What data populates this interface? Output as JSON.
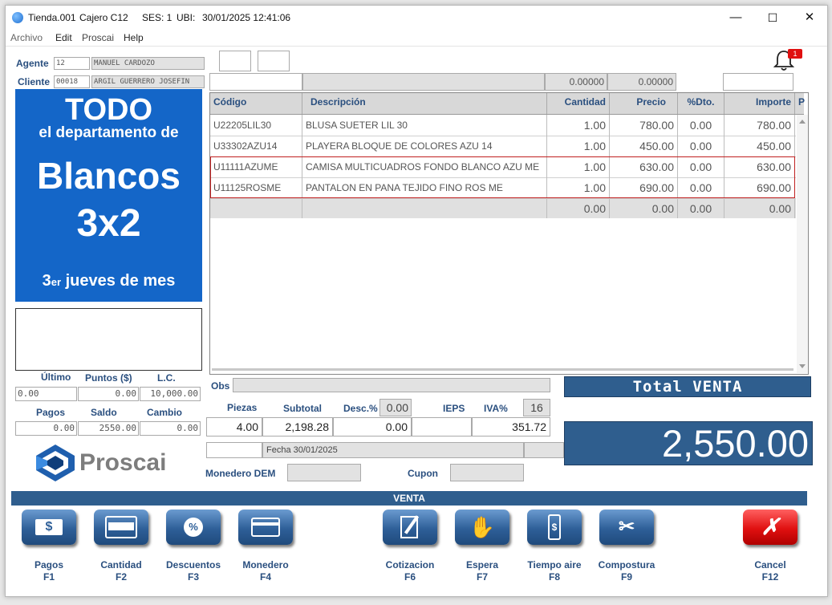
{
  "titlebar": {
    "store": "Tienda.001",
    "cashier": "Cajero C12",
    "session": "SES: 1",
    "ubi": "UBI:",
    "datetime": "30/01/2025 12:41:06",
    "minimize": "—",
    "maximize": "☐",
    "close": "✕"
  },
  "menu": {
    "archivo": "Archivo",
    "edit": "Edit",
    "proscai": "Proscai",
    "help": "Help"
  },
  "agent": {
    "label": "Agente",
    "code": "12",
    "name": "MANUEL CARDOZO"
  },
  "client": {
    "label": "Cliente",
    "code": "00018",
    "name": "ARGIL  GUERRERO JOSEFIN"
  },
  "notifications": {
    "count": "1",
    "icon": "bell-icon"
  },
  "top_fields": {
    "val1": "0.00000",
    "val2": "0.00000"
  },
  "banner": {
    "l1": "TODO",
    "l2": "el departamento de",
    "l3": "Blancos",
    "l4": "3x2",
    "l5_pre": "3",
    "l5_sup": "er",
    "l5_post": " jueves de mes"
  },
  "table": {
    "headers": [
      "Código",
      "Descripción",
      "Cantidad",
      "Precio",
      "%Dto.",
      "Importe",
      "P"
    ],
    "rows": [
      {
        "code": "U22205LIL30",
        "desc": "BLUSA SUETER LIL 30",
        "qty": "1.00",
        "price": "780.00",
        "dto": "0.00",
        "imp": "780.00"
      },
      {
        "code": "U33302AZU14",
        "desc": "PLAYERA BLOQUE DE COLORES AZU 14",
        "qty": "1.00",
        "price": "450.00",
        "dto": "0.00",
        "imp": "450.00"
      },
      {
        "code": "U11111AZUME",
        "desc": "CAMISA MULTICUADROS FONDO BLANCO AZU ME",
        "qty": "1.00",
        "price": "630.00",
        "dto": "0.00",
        "imp": "630.00"
      },
      {
        "code": "U11125ROSME",
        "desc": "PANTALON EN PANA  TEJIDO FINO ROS ME",
        "qty": "1.00",
        "price": "690.00",
        "dto": "0.00",
        "imp": "690.00"
      }
    ],
    "totals": {
      "qty": "0.00",
      "price": "0.00",
      "dto": "0.00",
      "imp": "0.00"
    }
  },
  "left_stats": {
    "ultimo_label": "Último",
    "puntos_label": "Puntos ($)",
    "lc_label": "L.C.",
    "ultimo": "0.00",
    "puntos": "0.00",
    "lc": "10,000.00",
    "pagos_label": "Pagos",
    "saldo_label": "Saldo",
    "cambio_label": "Cambio",
    "pagos": "0.00",
    "saldo": "2550.00",
    "cambio": "0.00"
  },
  "logo": {
    "name": "Proscai"
  },
  "obs": {
    "label": "Obs"
  },
  "totals": {
    "piezas_label": "Piezas",
    "subtotal_label": "Subtotal",
    "desc_label": "Desc.%",
    "desc_pct": "0.00",
    "ieps_label": "IEPS",
    "iva_label": "IVA%",
    "iva_pct": "16",
    "piezas": "4.00",
    "subtotal": "2,198.28",
    "descuento": "0.00",
    "ieps": "",
    "iva": "351.72",
    "fecha": "Fecha 30/01/2025"
  },
  "total_venta": {
    "label": "Total VENTA",
    "value": "2,550.00"
  },
  "monedero": {
    "label": "Monedero DEM",
    "cupon_label": "Cupon"
  },
  "mode_bar": "VENTA",
  "fkeys": [
    {
      "label": "Pagos",
      "key": "F1"
    },
    {
      "label": "Cantidad",
      "key": "F2"
    },
    {
      "label": "Descuentos",
      "key": "F3"
    },
    {
      "label": "Monedero",
      "key": "F4"
    },
    {
      "label": "Cotizacion",
      "key": "F6"
    },
    {
      "label": "Espera",
      "key": "F7"
    },
    {
      "label": "Tiempo aire",
      "key": "F8"
    },
    {
      "label": "Compostura",
      "key": "F9"
    },
    {
      "label": "Cancel",
      "key": "F12"
    }
  ],
  "colors": {
    "accent": "#2f5e8e",
    "banner": "#1466c8",
    "cancel": "#e01010",
    "label": "#2a4f7f"
  }
}
